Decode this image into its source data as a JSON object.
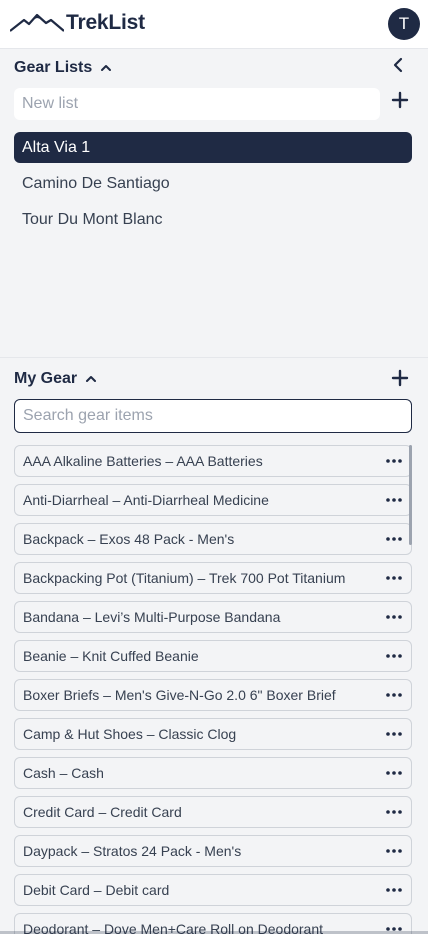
{
  "app": {
    "name": "TrekList",
    "user_initial": "T"
  },
  "gear_lists": {
    "title": "Gear Lists",
    "new_list_placeholder": "New list",
    "items": [
      {
        "label": "Alta Via 1",
        "active": true
      },
      {
        "label": "Camino De Santiago",
        "active": false
      },
      {
        "label": "Tour Du Mont Blanc",
        "active": false
      }
    ]
  },
  "my_gear": {
    "title": "My Gear",
    "search_placeholder": "Search gear items",
    "items": [
      "AAA Alkaline Batteries – AAA Batteries",
      "Anti-Diarrheal – Anti-Diarrheal Medicine",
      "Backpack – Exos 48 Pack - Men's",
      "Backpacking Pot (Titanium) – Trek 700 Pot Titanium",
      "Bandana – Levi’s Multi-Purpose Bandana",
      "Beanie – Knit Cuffed Beanie",
      "Boxer Briefs – Men's Give-N-Go 2.0 6\" Boxer Brief",
      "Camp & Hut Shoes – Classic Clog",
      "Cash – Cash",
      "Credit Card – Credit Card",
      "Daypack – Stratos 24 Pack - Men's",
      "Debit Card – Debit card",
      "Deodorant – Dove Men+Care Roll on Deodorant"
    ]
  },
  "icons": {
    "logo": "mountain-logo-icon",
    "collapse": "chevron-left-icon",
    "section_toggle": "chevron-up-icon",
    "add": "plus-icon",
    "item_menu": "more-horizontal-icon"
  },
  "colors": {
    "primary": "#1f2a44",
    "background": "#f3f4f6"
  }
}
